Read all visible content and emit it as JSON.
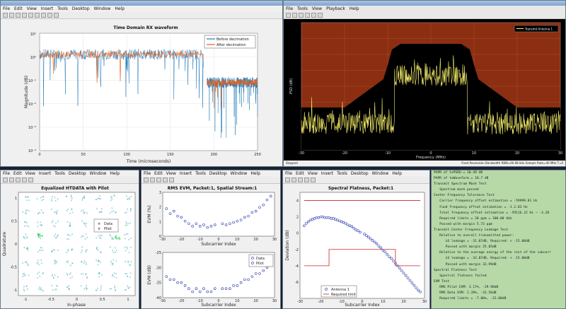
{
  "windows": {
    "rx": {
      "menu": [
        "File",
        "Edit",
        "View",
        "Insert",
        "Tools",
        "Desktop",
        "Window",
        "Help"
      ],
      "chart_data": {
        "type": "line",
        "title": "Time Domain RX waveform",
        "xlabel": "Time (microseconds)",
        "ylabel": "Magnitude (dB)",
        "xlim": [
          0,
          250
        ],
        "x_ticks": [
          "0",
          "50",
          "100",
          "150",
          "200",
          "250"
        ],
        "y_ticks": [
          "10⁻⁴",
          "10⁻³",
          "10⁻²",
          "10⁻¹",
          "10⁰",
          "10¹"
        ],
        "series": [
          {
            "name": "Before decimation",
            "color": "#1f77b4"
          },
          {
            "name": "After decimation",
            "color": "#e8601c"
          }
        ],
        "segments": [
          {
            "x_start": 0,
            "x_end": 188,
            "level_exp": 0.1
          },
          {
            "x_start": 192,
            "x_end": 250,
            "level_exp": -1.1
          }
        ]
      }
    },
    "spectrum": {
      "menu": [
        "File",
        "Tools",
        "View",
        "Playback",
        "Help"
      ],
      "chart_data": {
        "type": "line",
        "xlabel": "Frequency (MHz)",
        "ylabel": "PSD (dB)",
        "xlim": [
          -30,
          30
        ],
        "x_ticks": [
          "-30",
          "-20",
          "-10",
          "0",
          "10",
          "20",
          "30"
        ],
        "series": [
          {
            "name": "Transmit Antenna 1",
            "color": "#f5ee6a"
          }
        ]
      },
      "status_left": "Stopped",
      "status_right": "Fixed Resolution Bandwidth   RBW=60.98 kHz   Sample Rate=40 MHz   T=0"
    },
    "constellation": {
      "menu": [
        "File",
        "Edit",
        "View",
        "Insert",
        "Tools",
        "Desktop",
        "Window",
        "Help"
      ],
      "chart_data": {
        "type": "scatter",
        "title": "Equalized HTDATA with Pilot",
        "xlabel": "In-phase",
        "ylabel": "Quadrature",
        "x_ticks": [
          "-1",
          "-0.5",
          "0",
          "0.5",
          "1"
        ],
        "y_ticks": [
          "-1",
          "-0.5",
          "0",
          "0.5",
          "1"
        ],
        "series": [
          {
            "name": "Data",
            "color": "#2f9fb8"
          },
          {
            "name": "Pilot",
            "color": "#22d84a"
          }
        ]
      }
    },
    "evm": {
      "menu": [
        "File",
        "Edit",
        "View",
        "Insert",
        "Tools",
        "Desktop",
        "Window",
        "Help"
      ],
      "chart_data": [
        {
          "type": "scatter",
          "title": "RMS EVM, Packet:1, Spatial Stream:1",
          "xlabel": "Subcarrier Index",
          "ylabel": "EVM (%)",
          "x_ticks": [
            "-30",
            "-20",
            "-10",
            "0",
            "10",
            "20",
            "30"
          ],
          "y_ticks": [
            "0",
            "1",
            "2",
            "3"
          ],
          "x": [
            -28,
            -26,
            -24,
            -22,
            -20,
            -18,
            -16,
            -14,
            -12,
            -10,
            -8,
            -6,
            -4,
            -2,
            2,
            4,
            6,
            8,
            10,
            12,
            14,
            16,
            18,
            20,
            22,
            24,
            26,
            28
          ],
          "values": [
            2.2,
            1.8,
            2.0,
            1.6,
            1.5,
            1.2,
            1.0,
            0.8,
            1.0,
            0.8,
            0.9,
            0.7,
            0.8,
            0.9,
            1.0,
            0.9,
            1.0,
            1.1,
            1.2,
            1.3,
            1.5,
            1.6,
            1.9,
            2.0,
            2.3,
            2.5,
            2.9,
            3.2
          ]
        },
        {
          "type": "scatter",
          "xlabel": "Subcarrier Index",
          "ylabel": "EVM (dB)",
          "x_ticks": [
            "-30",
            "-20",
            "-10",
            "0",
            "10",
            "20",
            "30"
          ],
          "y_ticks": [
            "-40",
            "-35",
            "-30",
            "-25"
          ],
          "legend": [
            "Data",
            "Pilot"
          ],
          "x": [
            -28,
            -26,
            -24,
            -22,
            -20,
            -18,
            -16,
            -14,
            -12,
            -10,
            -8,
            -6,
            -4,
            -2,
            2,
            4,
            6,
            8,
            10,
            12,
            14,
            16,
            18,
            20,
            22,
            24,
            26,
            28
          ],
          "values": [
            -33,
            -34,
            -34,
            -35,
            -35,
            -36,
            -37,
            -38,
            -37,
            -38,
            -37,
            -38,
            -38,
            -37,
            -37,
            -37,
            -37,
            -36,
            -36,
            -35,
            -34,
            -34,
            -33,
            -32,
            -32,
            -31,
            -30,
            -29
          ]
        }
      ]
    },
    "flatness": {
      "menu": [
        "File",
        "Edit",
        "View",
        "Insert",
        "Tools",
        "Desktop",
        "Window",
        "Help"
      ],
      "chart_data": {
        "type": "scatter",
        "title": "Spectral Flatness, Packet:1",
        "xlabel": "Subcarrier Index",
        "ylabel": "Deviation (dB)",
        "x_ticks": [
          "-30",
          "-20",
          "-10",
          "0",
          "10",
          "20",
          "30"
        ],
        "y_ticks": [
          "-6",
          "-4",
          "-2",
          "0",
          "2",
          "4"
        ],
        "series": [
          {
            "name": "Antenna 1",
            "color": "#2233aa"
          },
          {
            "name": "Required limit",
            "color": "#cc2222"
          }
        ],
        "x": [
          -28,
          -27,
          -26,
          -25,
          -24,
          -23,
          -22,
          -21,
          -20,
          -19,
          -18,
          -17,
          -16,
          -15,
          -14,
          -13,
          -12,
          -11,
          -10,
          -9,
          -8,
          -7,
          -6,
          -5,
          -4,
          -3,
          -2,
          -1,
          1,
          2,
          3,
          4,
          5,
          6,
          7,
          8,
          9,
          10,
          11,
          12,
          13,
          14,
          15,
          16,
          17,
          18,
          19,
          20,
          21,
          22,
          23,
          24,
          25,
          26,
          27,
          28
        ],
        "values": [
          0.9,
          1.2,
          1.4,
          1.6,
          1.7,
          1.8,
          1.9,
          1.9,
          2.0,
          2.0,
          1.9,
          1.9,
          1.9,
          1.8,
          1.8,
          1.7,
          1.6,
          1.5,
          1.4,
          1.3,
          1.2,
          1.0,
          0.9,
          0.8,
          0.6,
          0.4,
          0.3,
          0.1,
          -0.1,
          -0.3,
          -0.5,
          -0.7,
          -0.9,
          -1.1,
          -1.3,
          -1.6,
          -1.8,
          -2.1,
          -2.3,
          -2.6,
          -2.9,
          -3.1,
          -3.4,
          -3.7,
          -4.0,
          -4.3,
          -4.6,
          -4.9,
          -5.2,
          -5.5,
          -5.8,
          -6.1,
          -6.4,
          -6.7,
          -7.0,
          -7.2
        ]
      }
    }
  },
  "console_lines": [
    "PAPR of txPSDU = 10.49 dB",
    "PAPR of txWaveform = 10.7 dB",
    "Transmit Spectrum Mask Test",
    "   Spectrum mask passed",
    "Center Frequency Tolerance Test",
    "   Carrier frequency offset estimation = -59999.81 Hz",
    "   Fund frequency offset estimation = -1.2.83 Hz",
    "   Total frequency offset estimation = -59116.22 Hz ~ -3.28",
    "   Required limits = 20 ppm = 100.00 kHz",
    "   Passed with margin 5.73 ppm",
    "Transmit Center Frequency Leakage Test",
    "   Relative to overall transmitted power:",
    "      LO leakage = -31.07dB, Required: < -15.00dB",
    "      Passed with margin 25.05dB",
    "   Relative to the average energy of the rest of the subcarr",
    "      LO leakage = -32.07dB, Required: < -15.00dB",
    "      Passed with margin 32.99dB",
    "Spectral Flatness Test",
    "   Spectral flatness failed",
    "EVM Test",
    "   RMS Pilot EVM: 3.17%, -29.98dB",
    "   RMS Data EVM: 2.39%, -32.56dB",
    "   Required limits = -7.00%, -22.00dB"
  ]
}
